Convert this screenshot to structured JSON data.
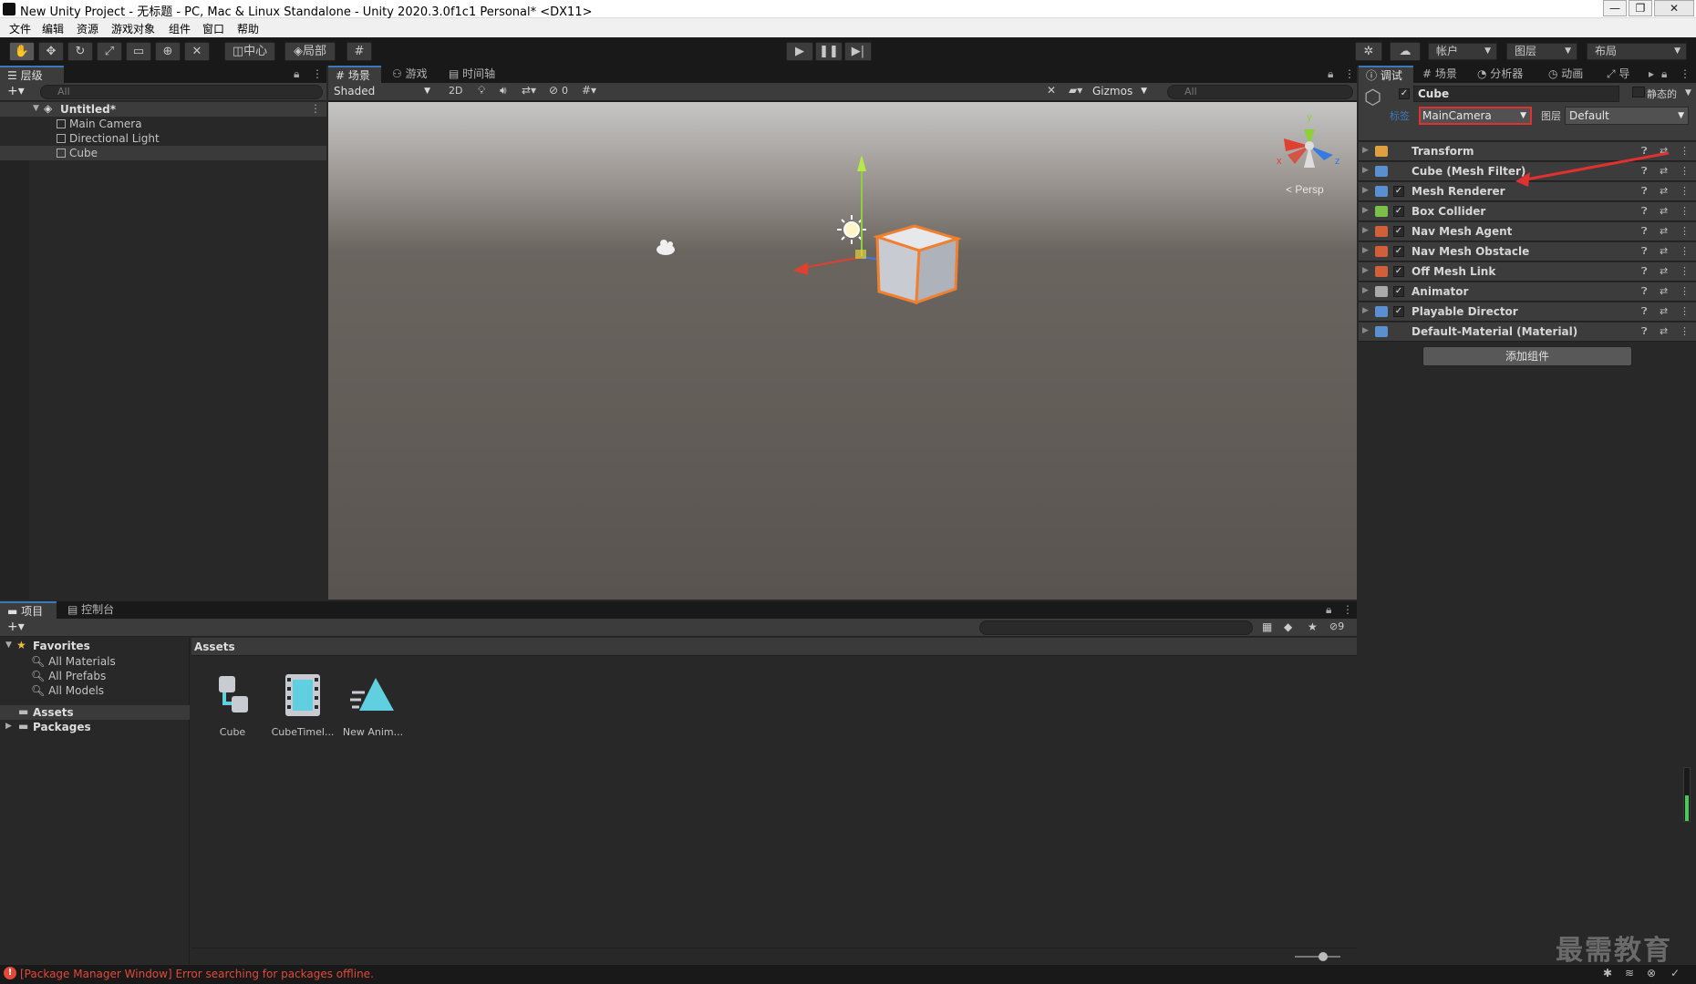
{
  "window": {
    "title": "New Unity Project - 无标题 - PC, Mac & Linux Standalone - Unity 2020.3.0f1c1 Personal* <DX11>",
    "controls": [
      "—",
      "❐",
      "✕"
    ]
  },
  "menu": [
    "文件",
    "编辑",
    "资源",
    "游戏对象",
    "组件",
    "窗口",
    "帮助"
  ],
  "toolbar": {
    "pivot_label": "中心",
    "local_label": "局部",
    "account_label": "帐户",
    "layers_label": "图层",
    "layout_label": "布局"
  },
  "hierarchy": {
    "tab_label": "层级",
    "search_placeholder": "All",
    "scene_name": "Untitled*",
    "items": [
      "Main Camera",
      "Directional Light",
      "Cube"
    ]
  },
  "scene": {
    "tabs": [
      "场景",
      "游戏",
      "时间轴"
    ],
    "shading_mode": "Shaded",
    "mode_2d": "2D",
    "hidden_count": "0",
    "gizmos_label": "Gizmos",
    "search_placeholder": "All",
    "persp_label": "< Persp",
    "axis_y": "y",
    "axis_x": "x",
    "axis_z": "z"
  },
  "inspector": {
    "tabs": [
      "调试",
      "场景",
      "分析器",
      "动画",
      "导"
    ],
    "object_name": "Cube",
    "static_label": "静态的",
    "tag_label": "标签",
    "tag_value": "MainCamera",
    "layer_label": "图层",
    "layer_value": "Default",
    "components": [
      {
        "name": "Transform",
        "checkbox": false,
        "icon_color": "#e0a040"
      },
      {
        "name": "Cube (Mesh Filter)",
        "checkbox": false,
        "icon_color": "#5a8fd0"
      },
      {
        "name": "Mesh Renderer",
        "checkbox": true,
        "icon_color": "#5a8fd0"
      },
      {
        "name": "Box Collider",
        "checkbox": true,
        "icon_color": "#7cc04a"
      },
      {
        "name": "Nav Mesh Agent",
        "checkbox": true,
        "icon_color": "#d0603a"
      },
      {
        "name": "Nav Mesh Obstacle",
        "checkbox": true,
        "icon_color": "#d0603a"
      },
      {
        "name": "Off Mesh Link",
        "checkbox": true,
        "icon_color": "#d0603a"
      },
      {
        "name": "Animator",
        "checkbox": true,
        "icon_color": "#aaaaaa"
      },
      {
        "name": "Playable Director",
        "checkbox": true,
        "icon_color": "#5a8fd0"
      },
      {
        "name": "Default-Material (Material)",
        "checkbox": false,
        "icon_color": "#5a8fd0"
      }
    ],
    "add_component_label": "添加组件"
  },
  "project": {
    "tabs": [
      "项目",
      "控制台"
    ],
    "hidden_count": "9",
    "favorites_label": "Favorites",
    "favorites": [
      "All Materials",
      "All Prefabs",
      "All Models"
    ],
    "folders": [
      "Assets",
      "Packages"
    ],
    "breadcrumb": "Assets",
    "assets": [
      "Cube",
      "CubeTimel...",
      "New Anim..."
    ]
  },
  "status": {
    "error_message": "[Package Manager Window] Error searching for packages offline."
  },
  "watermark": "最需教育",
  "colors": {
    "accent": "#3a79bb",
    "error": "#e04a3a",
    "highlight_box": "#e03030",
    "selection_orange": "#f08030"
  }
}
